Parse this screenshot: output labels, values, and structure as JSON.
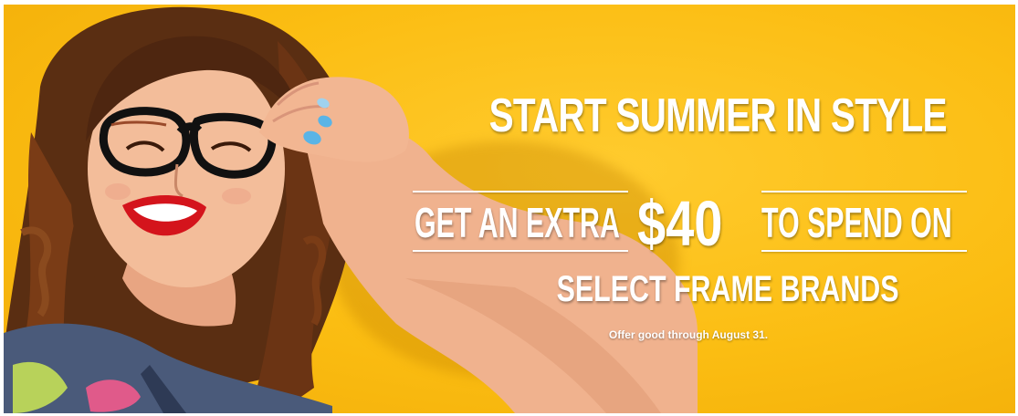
{
  "banner": {
    "headline": "START SUMMER IN STYLE",
    "offer_prefix": "GET AN EXTRA",
    "offer_amount": "$40",
    "offer_suffix": "TO SPEND ON",
    "subheadline": "SELECT FRAME BRANDS",
    "fine_print": "Offer good through August 31.",
    "colors": {
      "background": "#fbbd12",
      "text": "#ffffff",
      "lips": "#d4141c",
      "nails": "#5ab4e6"
    },
    "image": "smiling woman wearing black glasses"
  }
}
